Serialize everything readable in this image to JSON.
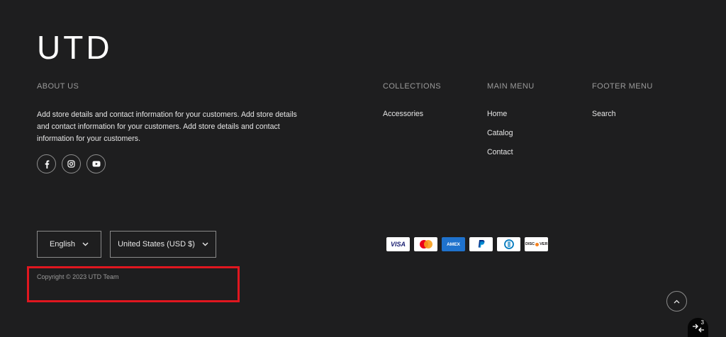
{
  "brand": {
    "logo_text": "UTD"
  },
  "about": {
    "heading": "ABOUT US",
    "text": "Add store details and contact information for your customers. Add store details and contact information for your customers. Add store details and contact information for your customers."
  },
  "social": [
    "facebook-icon",
    "instagram-icon",
    "youtube-icon"
  ],
  "collections": {
    "heading": "COLLECTIONS",
    "links": [
      "Accessories"
    ]
  },
  "main_menu": {
    "heading": "MAIN MENU",
    "links": [
      "Home",
      "Catalog",
      "Contact"
    ]
  },
  "footer_menu": {
    "heading": "FOOTER MENU",
    "links": [
      "Search"
    ]
  },
  "selectors": {
    "language": "English",
    "country": "United States (USD $)"
  },
  "payments": [
    "VISA",
    "Mastercard",
    "AMEX",
    "PayPal",
    "Diners Club",
    "DISCOVER"
  ],
  "copyright": "Copyright © 2023 UTD Team",
  "accessibility_badge": "3",
  "colors": {
    "background": "#1e1e1f",
    "highlight": "#e0171f",
    "text": "#e6e6e6",
    "muted": "#9a9a9a"
  }
}
